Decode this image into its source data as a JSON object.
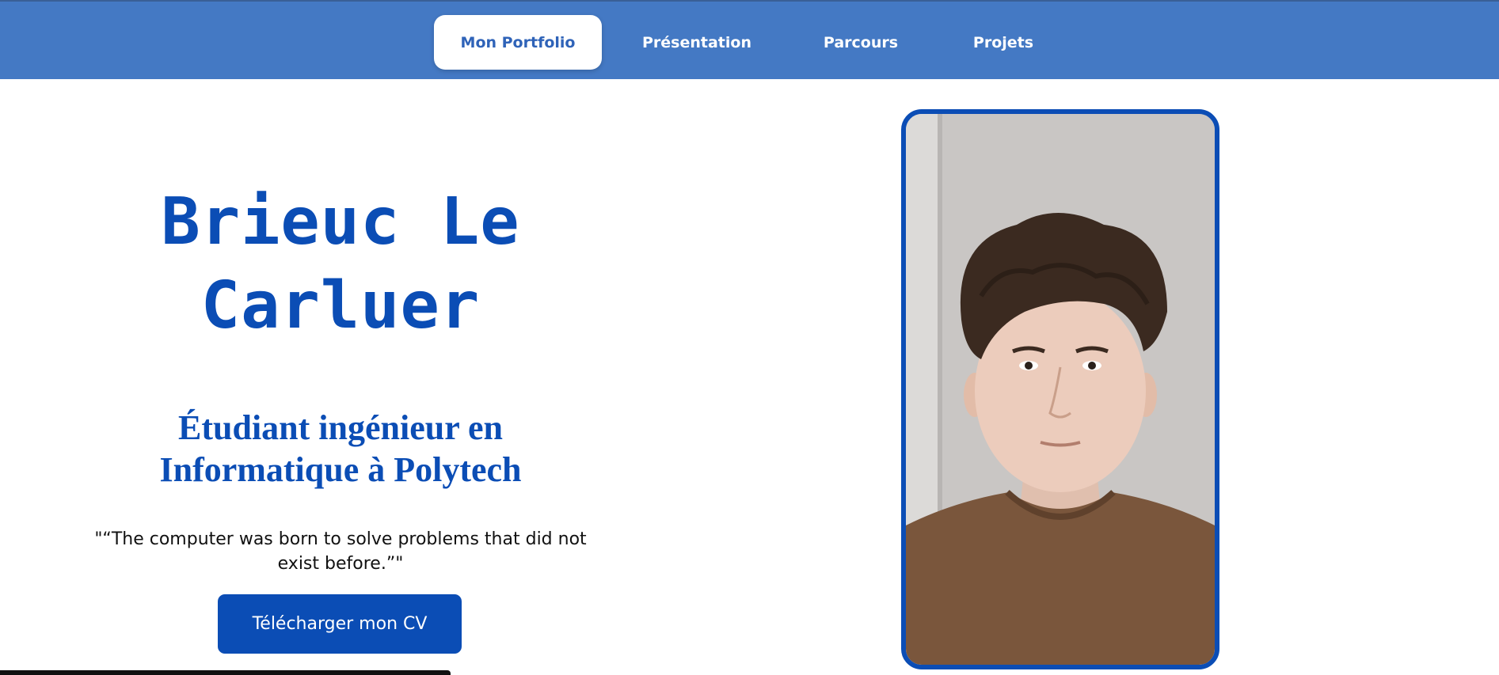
{
  "nav": {
    "items": [
      {
        "label": "Mon Portfolio",
        "active": true
      },
      {
        "label": "Présentation",
        "active": false
      },
      {
        "label": "Parcours",
        "active": false
      },
      {
        "label": "Projets",
        "active": false
      }
    ]
  },
  "hero": {
    "name": "Brieuc Le Carluer",
    "subtitle": "Étudiant ingénieur en Informatique à Polytech",
    "quote": "\"“The computer was born to solve problems that did not exist before.”\"",
    "cv_button": "Télécharger mon CV"
  },
  "colors": {
    "navbar": "#4479c4",
    "accent": "#0b4db5",
    "background": "#ffffff"
  }
}
